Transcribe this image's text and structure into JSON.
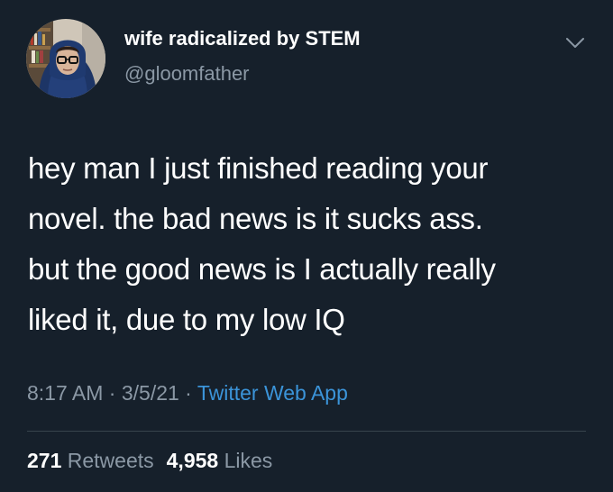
{
  "author": {
    "display_name": "wife radicalized by STEM",
    "handle": "@gloomfather",
    "avatar_icon": "profile-avatar"
  },
  "menu_icon": "chevron-down-icon",
  "tweet": {
    "text": "hey man I just finished reading your\nnovel. the bad news is it sucks ass.\nbut the good news is I actually really\nliked it, due to my low IQ"
  },
  "meta": {
    "time": "8:17 AM",
    "sep1": " · ",
    "date": "3/5/21",
    "sep2": " · ",
    "source": "Twitter Web App"
  },
  "stats": {
    "retweets_count": "271",
    "retweets_label": "Retweets",
    "likes_count": "4,958",
    "likes_label": "Likes"
  },
  "colors": {
    "background": "#16202b",
    "text": "#ffffff",
    "secondary_text": "#8b98a5",
    "link": "#3b94d9",
    "divider": "#38444d"
  }
}
